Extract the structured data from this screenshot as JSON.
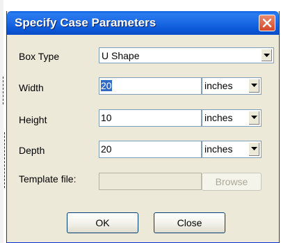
{
  "dialog": {
    "title": "Specify Case Parameters",
    "close_icon": "close-icon"
  },
  "fields": {
    "box_type": {
      "label": "Box Type",
      "value": "U Shape"
    },
    "width": {
      "label": "Width",
      "value": "20",
      "unit": "inches"
    },
    "height": {
      "label": "Height",
      "value": "10",
      "unit": "inches"
    },
    "depth": {
      "label": "Depth",
      "value": "20",
      "unit": "inches"
    },
    "template": {
      "label": "Template file:",
      "value": "",
      "browse_label": "Browse"
    }
  },
  "buttons": {
    "ok_label": "OK",
    "close_label": "Close"
  },
  "colors": {
    "title_bar": "#0a56d6",
    "dialog_bg": "#ece9d8",
    "close_button": "#d5482b",
    "selection": "#316ac5"
  }
}
